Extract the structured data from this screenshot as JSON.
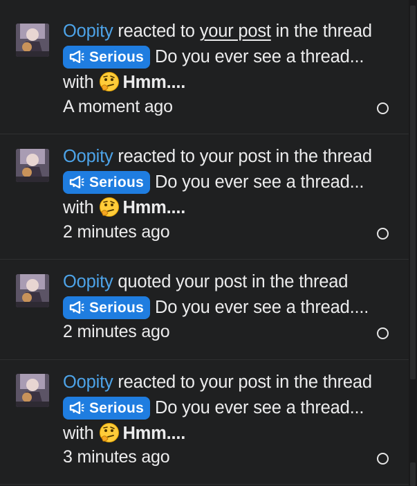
{
  "notifications": [
    {
      "user": "Oopity",
      "action": " reacted to ",
      "link": "your post",
      "after_link": " in the thread ",
      "prefix_label": "Serious",
      "thread": " Do you ever see a thread... with ",
      "reaction": "Hmm....",
      "time": "A moment ago"
    },
    {
      "user": "Oopity",
      "action": " reacted to ",
      "link": "your post",
      "after_link": " in the thread ",
      "prefix_label": "Serious",
      "thread": " Do you ever see a thread... with ",
      "reaction": "Hmm....",
      "time": "2 minutes ago"
    },
    {
      "user": "Oopity",
      "action": " quoted ",
      "link": "your post",
      "after_link": " in the thread ",
      "prefix_label": "Serious",
      "thread": " Do you ever see a thread....",
      "time": "2 minutes ago"
    },
    {
      "user": "Oopity",
      "action": " reacted to ",
      "link": "your post",
      "after_link": " in the thread ",
      "prefix_label": "Serious",
      "thread": " Do you ever see a thread... with ",
      "reaction": "Hmm....",
      "time": "3 minutes ago"
    }
  ],
  "colors": {
    "background": "#1f2021",
    "username": "#4da3e8",
    "prefix_badge": "#1f7de0",
    "text": "#ececed"
  },
  "icons": {
    "prefix": "megaphone-icon",
    "reaction": "thinking-face-emoji",
    "read_marker": "circle-outline-icon"
  }
}
